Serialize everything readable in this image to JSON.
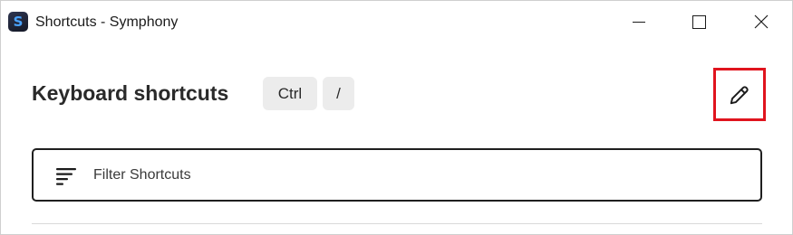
{
  "window": {
    "title": "Shortcuts - Symphony",
    "app_icon_letter": "S"
  },
  "header": {
    "title": "Keyboard shortcuts",
    "keys": [
      "Ctrl",
      "/"
    ]
  },
  "filter": {
    "placeholder": "Filter Shortcuts",
    "value": ""
  },
  "colors": {
    "highlight_border": "#e0141e",
    "key_background": "#ececec",
    "app_icon_letter": "#4aa3ff"
  },
  "icons": {
    "edit": "pencil-icon",
    "filter": "filter-lines-icon",
    "minimize": "minimize-icon",
    "maximize": "maximize-icon",
    "close": "close-icon"
  }
}
